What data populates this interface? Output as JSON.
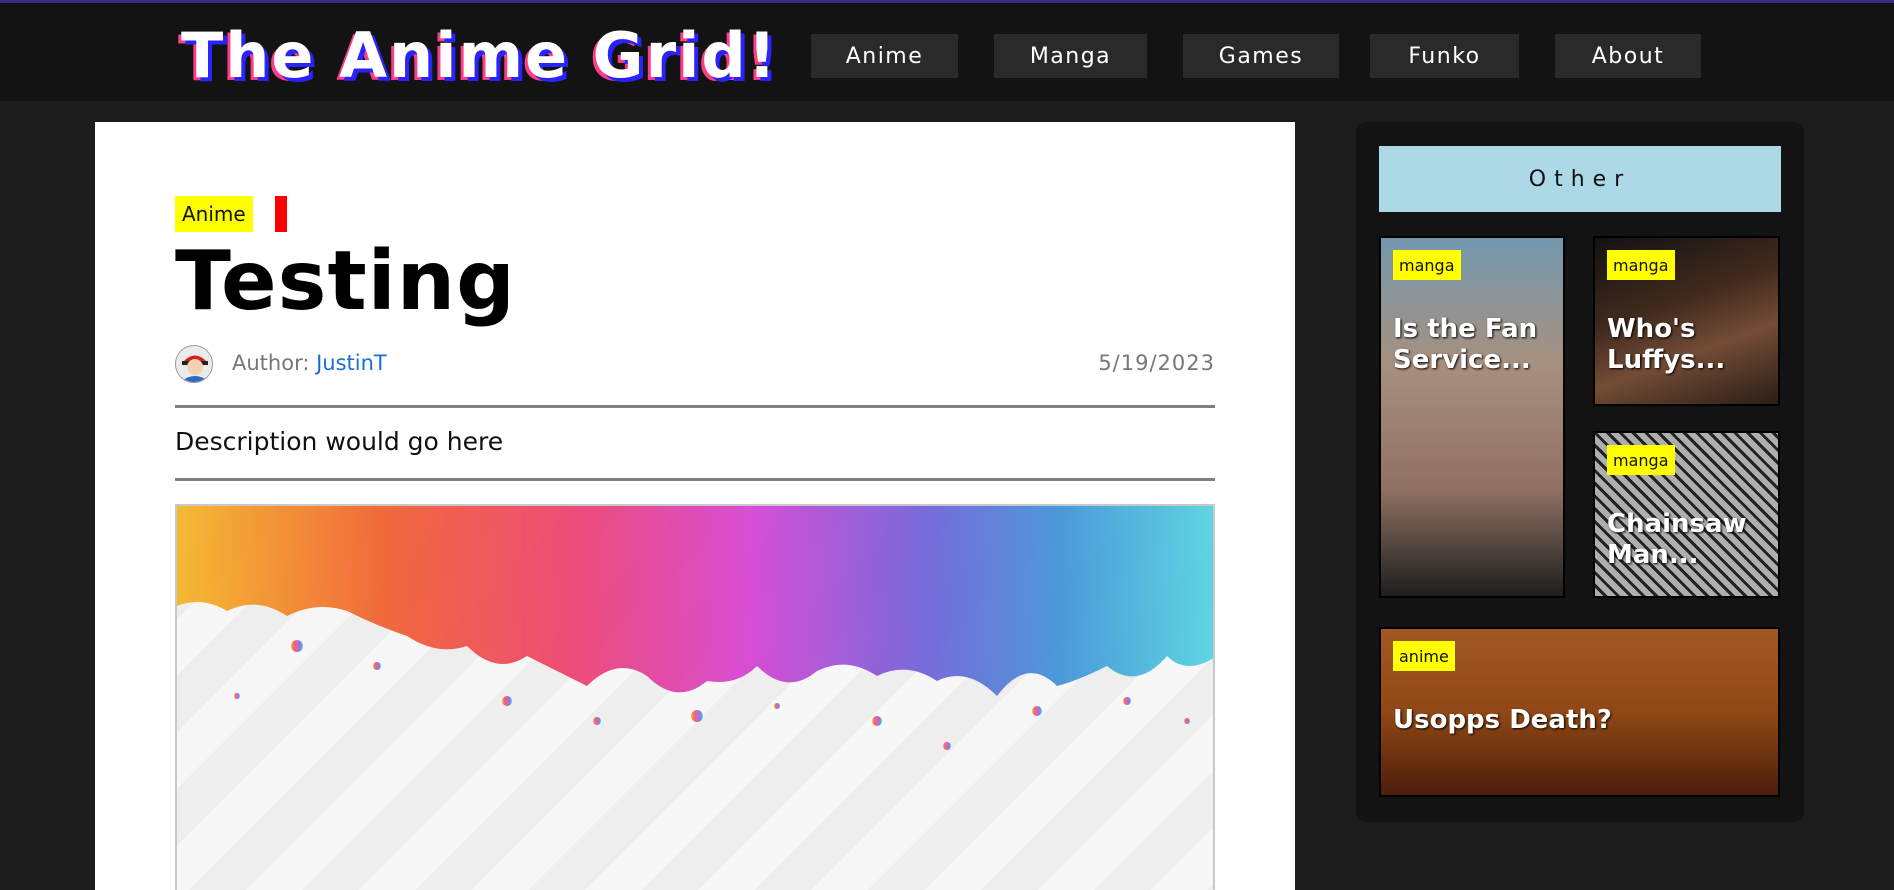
{
  "site": {
    "title": "The Anime Grid!"
  },
  "nav": {
    "items": [
      {
        "label": "Anime"
      },
      {
        "label": "Manga"
      },
      {
        "label": "Games"
      },
      {
        "label": "Funko"
      },
      {
        "label": "About"
      }
    ]
  },
  "article": {
    "category": "Anime",
    "title": "Testing",
    "author_label": "Author:",
    "author_name": "JustinT",
    "date": "5/19/2023",
    "description": "Description would go here"
  },
  "sidebar": {
    "heading": "Other",
    "cards": [
      {
        "badge": "manga",
        "title": "Is the Fan Service..."
      },
      {
        "badge": "manga",
        "title": "Who's Luffys..."
      },
      {
        "badge": "manga",
        "title": "Chainsaw Man..."
      },
      {
        "badge": "anime",
        "title": "Usopps Death?"
      }
    ]
  },
  "colors": {
    "accent_yellow": "#ffff00",
    "accent_red": "#ff0000",
    "link_blue": "#1b6fd6",
    "sidebar_header": "#add8e6",
    "topbar": "#131313",
    "page_bg": "#1c1c1c"
  },
  "icons": {
    "avatar": "user-avatar-icon"
  }
}
